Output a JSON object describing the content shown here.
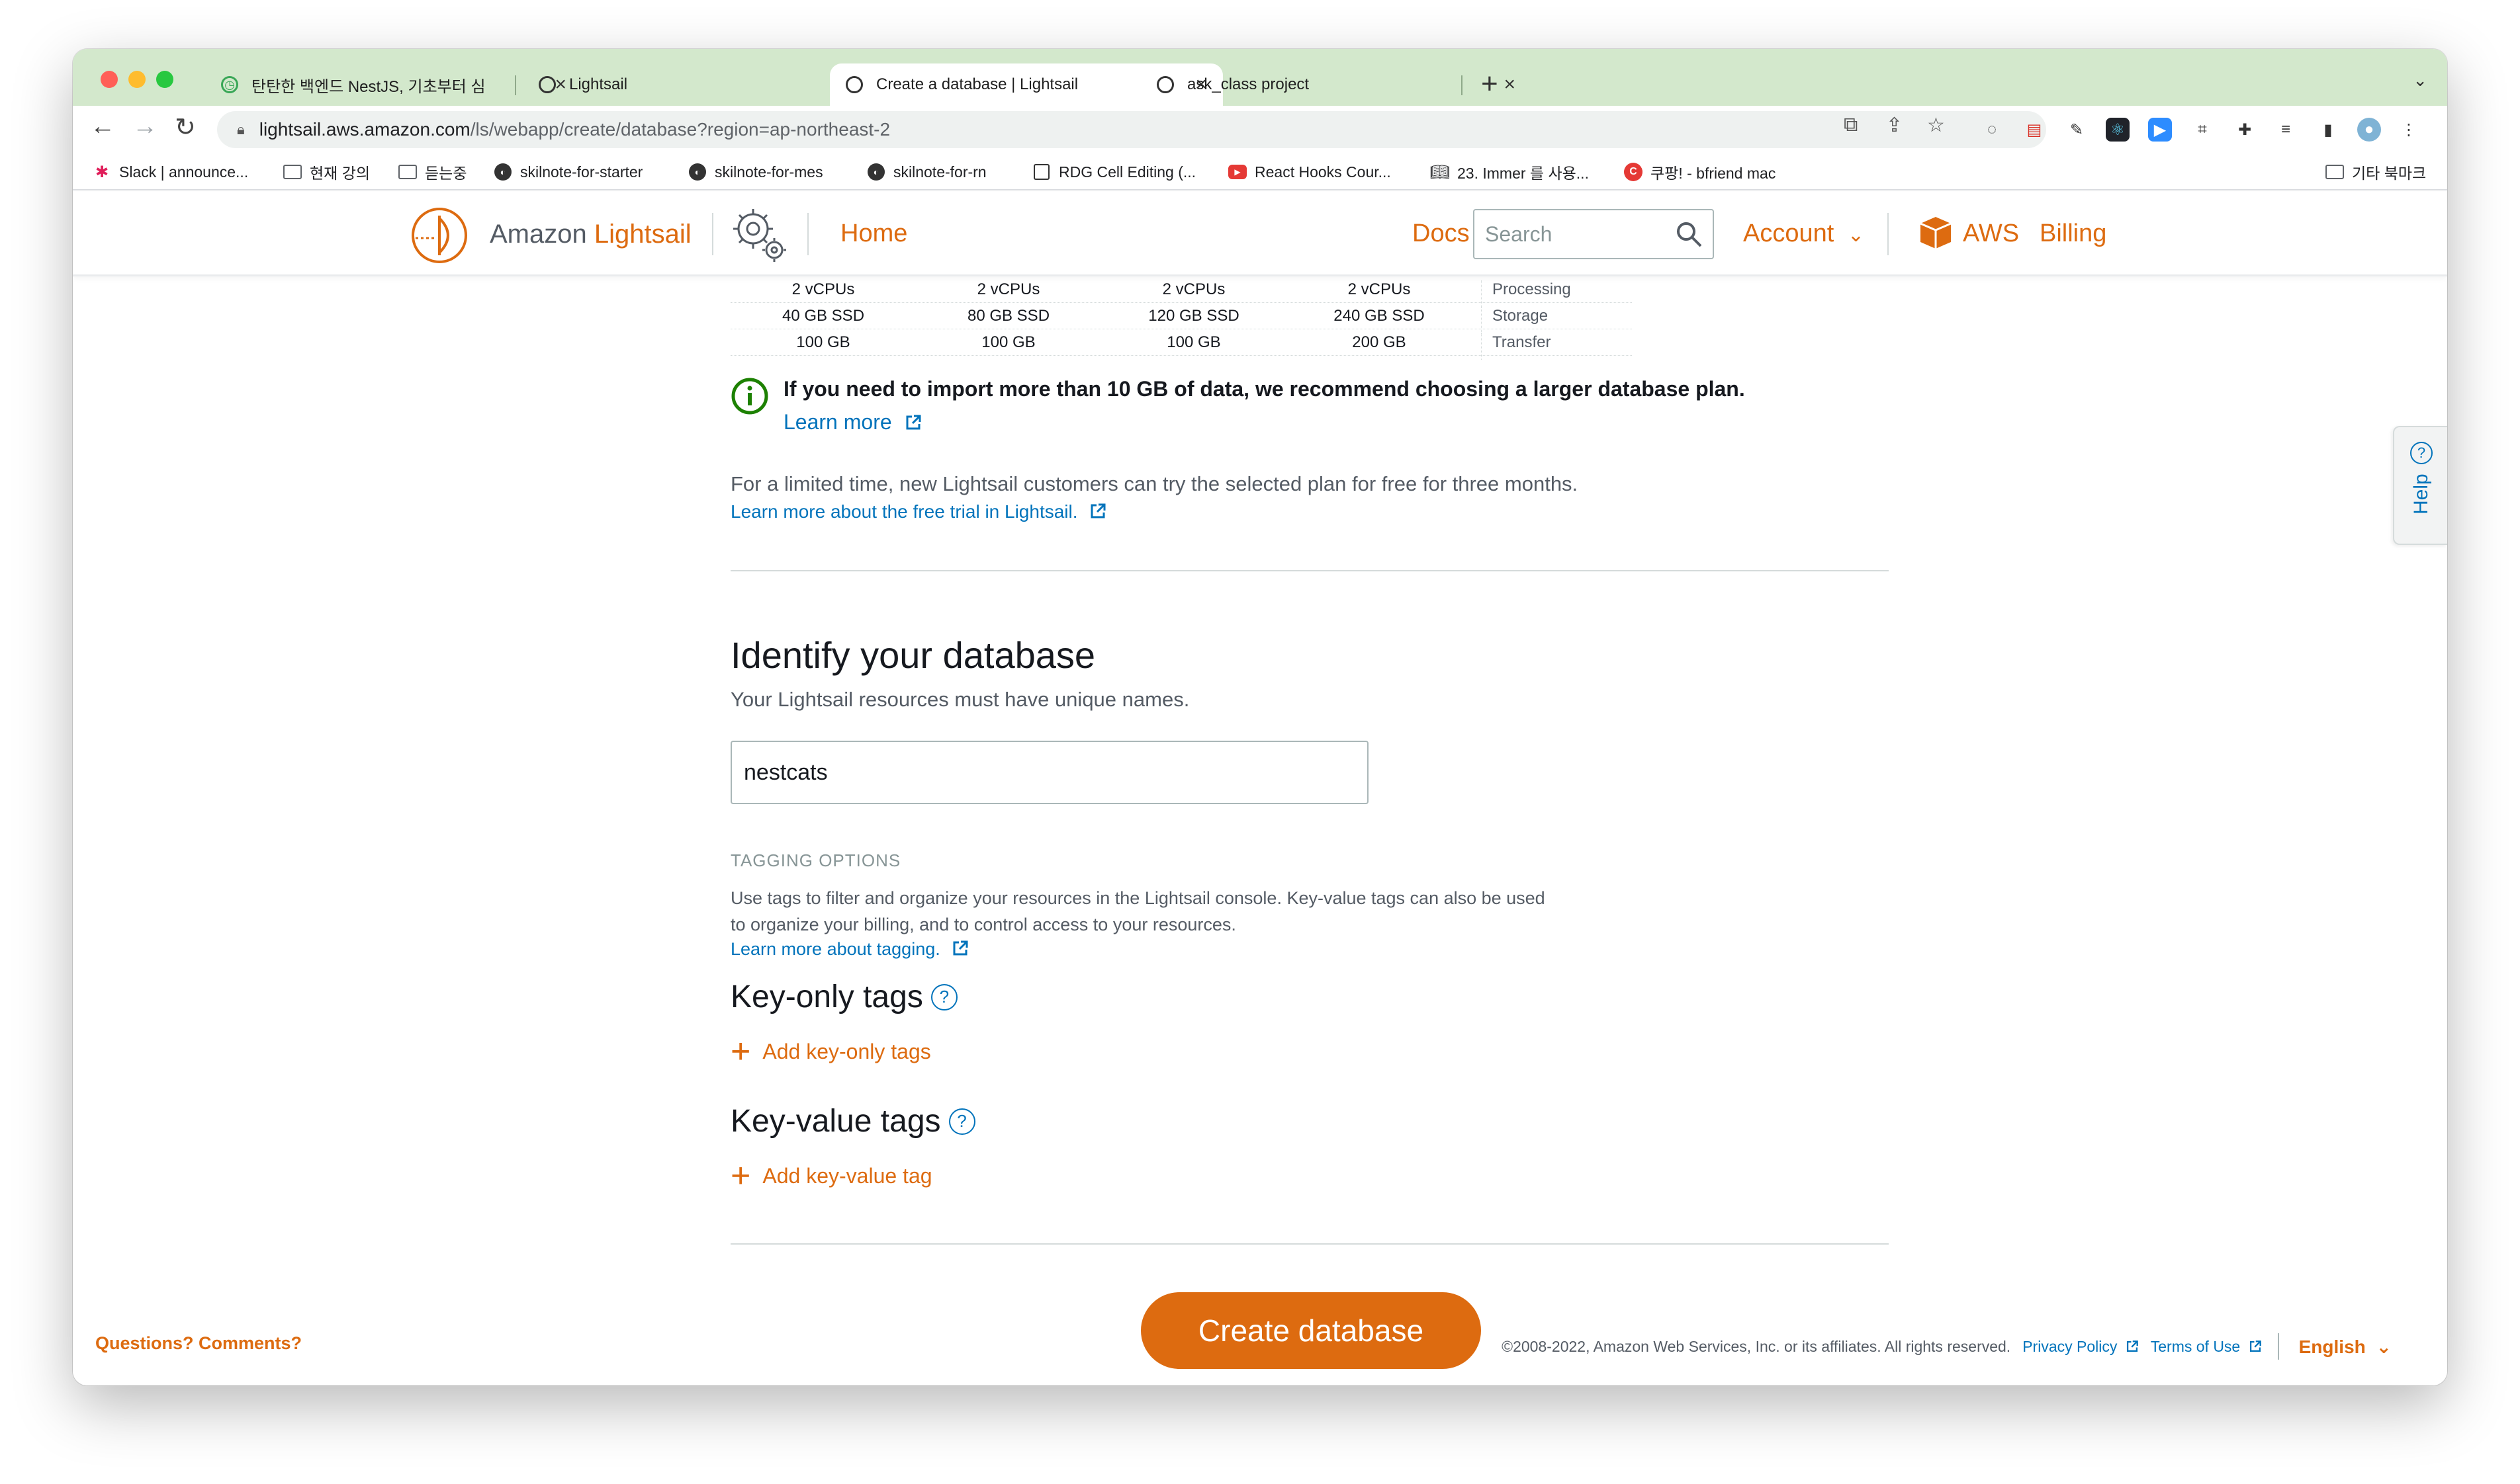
{
  "browser": {
    "tabs": [
      {
        "title": "탄탄한 백엔드 NestJS, 기초부터 심",
        "favicon": "inflearn-icon"
      },
      {
        "title": "Lightsail",
        "favicon": "globe-icon"
      },
      {
        "title": "Create a database | Lightsail",
        "favicon": "globe-icon",
        "active": true
      },
      {
        "title": "ask_class project",
        "favicon": "globe-icon"
      }
    ],
    "new_tab": "+",
    "url_host": "lightsail.aws.amazon.com",
    "url_path": "/ls/webapp/create/database?region=ap-northeast-2",
    "bookmarks": [
      {
        "label": "Slack | announce...",
        "icon": "slack-icon"
      },
      {
        "label": "현재 강의",
        "icon": "folder-icon"
      },
      {
        "label": "듣는중",
        "icon": "folder-icon"
      },
      {
        "label": "skilnote-for-starter",
        "icon": "globe-icon"
      },
      {
        "label": "skilnote-for-mes",
        "icon": "globe-icon"
      },
      {
        "label": "skilnote-for-rn",
        "icon": "globe-icon"
      },
      {
        "label": "RDG Cell Editing (...",
        "icon": "square-icon"
      },
      {
        "label": "React Hooks Cour...",
        "icon": "youtube-icon"
      },
      {
        "label": "23. Immer 를 사용...",
        "icon": "book-icon"
      },
      {
        "label": "쿠팡! - bfriend mac",
        "icon": "coupang-icon"
      }
    ],
    "other_bookmarks": "기타 북마크"
  },
  "header": {
    "brand_prefix": "Amazon ",
    "brand_accent": "Lightsail",
    "home": "Home",
    "docs": "Docs",
    "search_placeholder": "Search",
    "account": "Account",
    "aws": "AWS",
    "billing": "Billing"
  },
  "plans": {
    "rows": [
      {
        "cells": [
          "2 vCPUs",
          "2 vCPUs",
          "2 vCPUs",
          "2 vCPUs"
        ],
        "label": "Processing"
      },
      {
        "cells": [
          "40 GB SSD",
          "80 GB SSD",
          "120 GB SSD",
          "240 GB SSD"
        ],
        "label": "Storage"
      },
      {
        "cells": [
          "100 GB",
          "100 GB",
          "100 GB",
          "200 GB"
        ],
        "label": "Transfer"
      }
    ]
  },
  "info": {
    "message": "If you need to import more than 10 GB of data, we recommend choosing a larger database plan.",
    "learn_more": "Learn more"
  },
  "trial": {
    "text": "For a limited time, new Lightsail customers can try the selected plan for free for three months.",
    "link": "Learn more about the free trial in Lightsail."
  },
  "identify": {
    "heading": "Identify your database",
    "subtitle": "Your Lightsail resources must have unique names.",
    "name_value": "nestcats"
  },
  "tagging": {
    "heading": "TAGGING OPTIONS",
    "description": "Use tags to filter and organize your resources in the Lightsail console. Key-value tags can also be used to organize your billing, and to control access to your resources.",
    "learn_more": "Learn more about tagging.",
    "key_only_heading": "Key-only tags",
    "add_key_only": "Add key-only tags",
    "key_value_heading": "Key-value tags",
    "add_key_value": "Add key-value tag"
  },
  "create_button": "Create database",
  "footer": {
    "questions": "Questions? Comments?",
    "copyright": "©2008-2022, Amazon Web Services, Inc. or its affiliates. All rights reserved.",
    "privacy": "Privacy Policy",
    "terms": "Terms of Use",
    "language": "English"
  },
  "help_tab": "Help",
  "colors": {
    "accent": "#dd6b10",
    "link": "#0073bb",
    "info_green": "#1d8102",
    "tabstrip": "#d3e8cc"
  }
}
